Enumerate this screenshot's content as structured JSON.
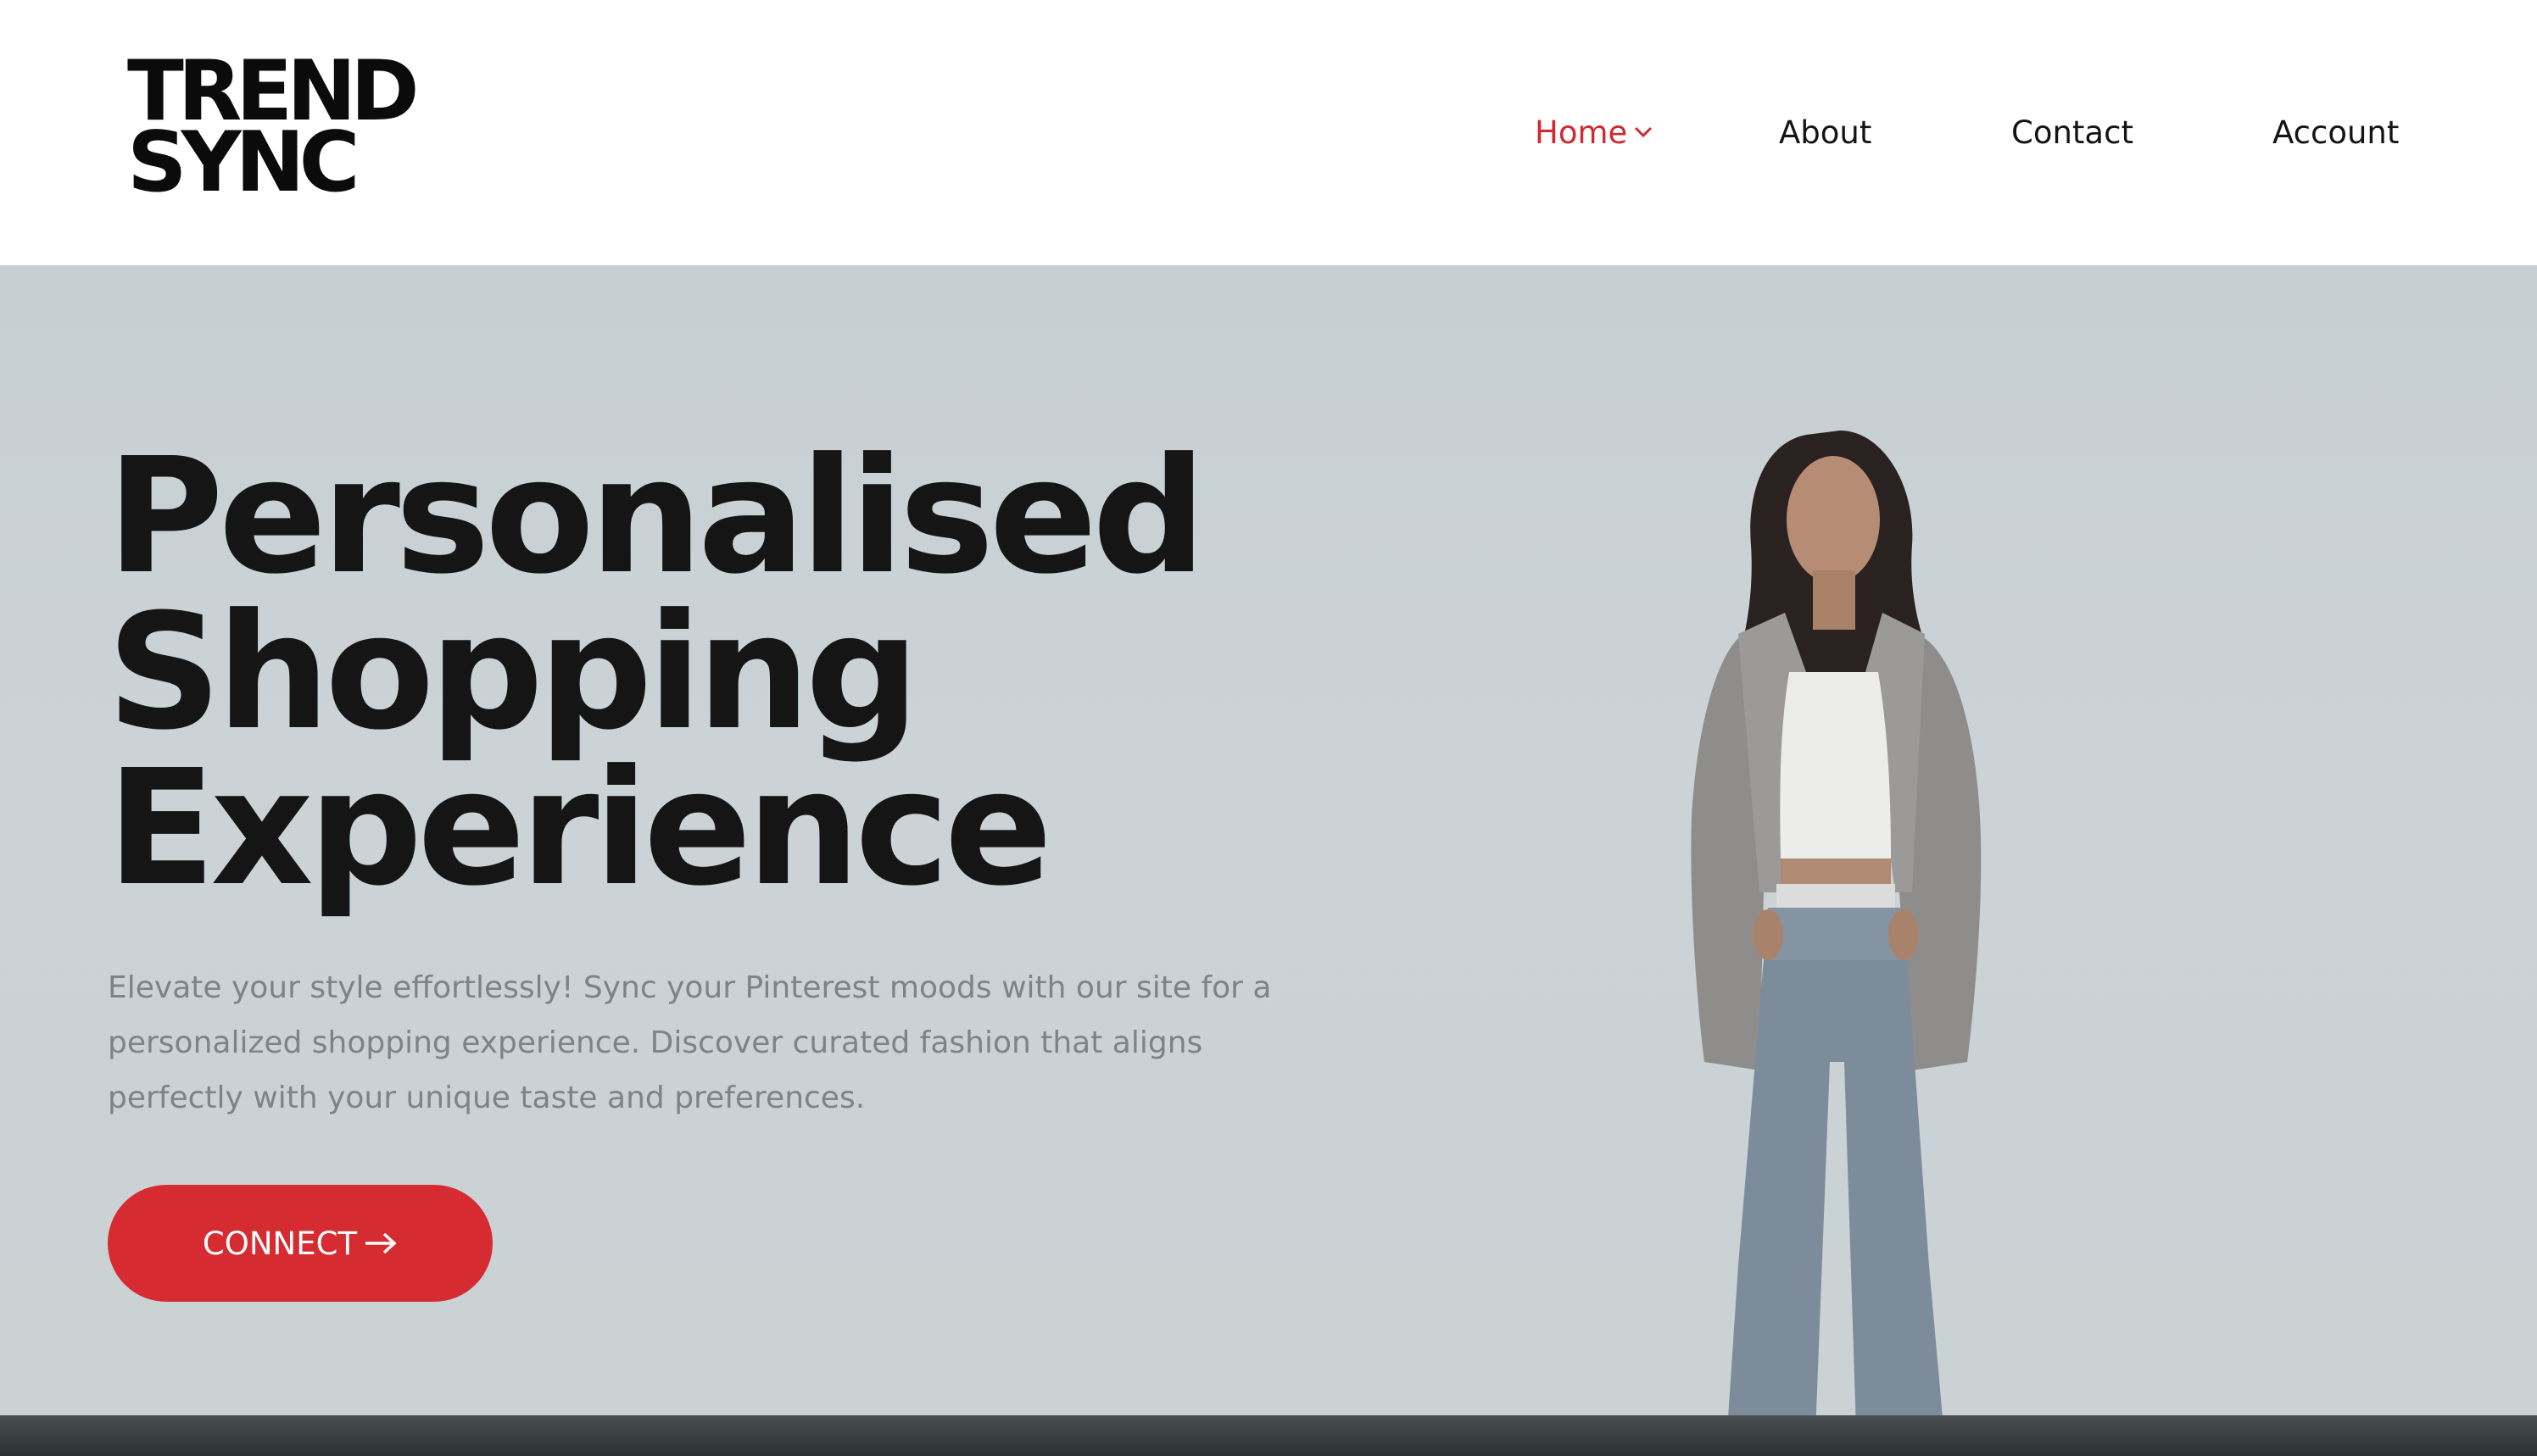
{
  "header": {
    "logo": {
      "line1": "TREND",
      "line2": "SYNC"
    },
    "nav": [
      {
        "label": "Home",
        "active": true,
        "icon": "chevron-down-icon"
      },
      {
        "label": "About",
        "active": false
      },
      {
        "label": "Contact",
        "active": false
      },
      {
        "label": "Account",
        "active": false
      }
    ]
  },
  "hero": {
    "title_lines": [
      "Personalised",
      "Shopping",
      "Experience"
    ],
    "description": "Elevate your style effortlessly! Sync your Pinterest moods with our site for a personalized shopping experience. Discover curated fashion that aligns perfectly with your unique taste and preferences.",
    "cta_label": "CONNECT",
    "cta_icon": "arrow-right-icon"
  },
  "colors": {
    "accent": "#d52b31",
    "nav_active": "#cf2a32",
    "text_dark": "#151515",
    "text_muted": "#7c8487",
    "hero_bg": "#c8d0d4"
  }
}
